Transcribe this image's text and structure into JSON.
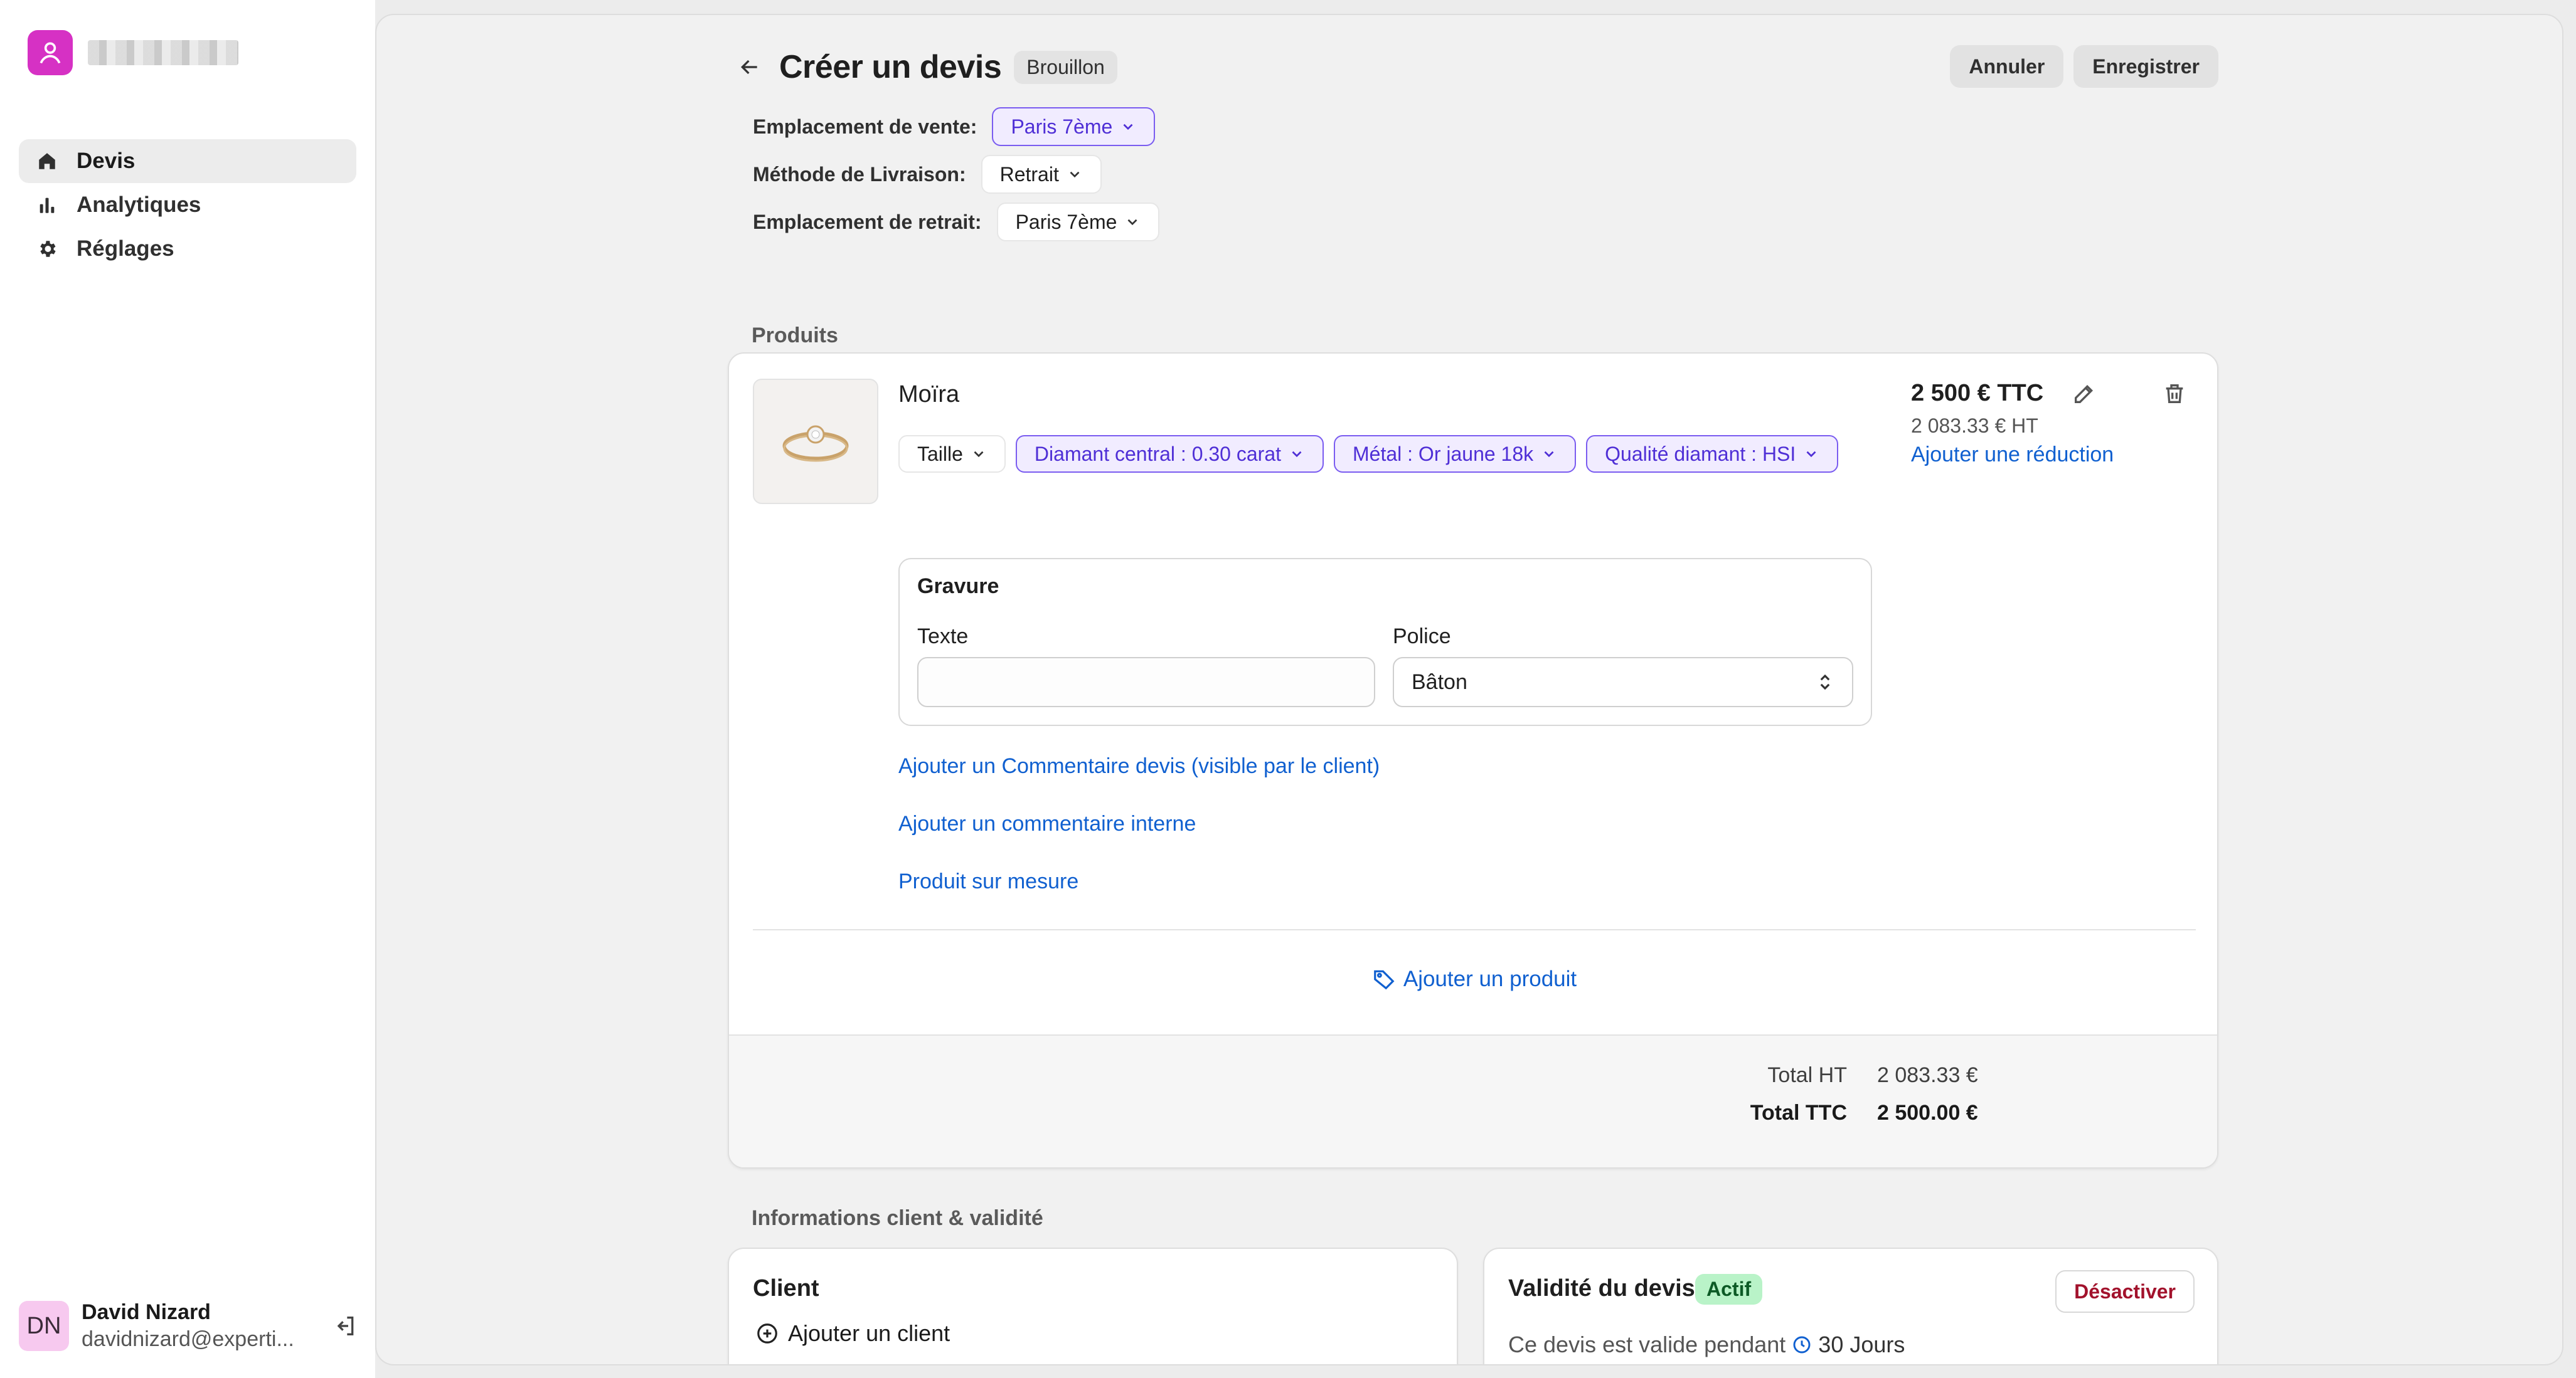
{
  "sidebar": {
    "items": [
      {
        "label": "Devis",
        "icon": "home-icon",
        "active": true
      },
      {
        "label": "Analytiques",
        "icon": "bar-chart-icon"
      },
      {
        "label": "Réglages",
        "icon": "gear-icon"
      }
    ],
    "user": {
      "initials": "DN",
      "name": "David Nizard",
      "email": "davidnizard@experti..."
    }
  },
  "header": {
    "title": "Créer un devis",
    "status": "Brouillon",
    "cancel_label": "Annuler",
    "save_label": "Enregistrer"
  },
  "meta": {
    "sale_location_label": "Emplacement de vente:",
    "sale_location_value": "Paris 7ème",
    "delivery_label": "Méthode de Livraison:",
    "delivery_value": "Retrait",
    "pickup_label": "Emplacement de retrait:",
    "pickup_value": "Paris 7ème"
  },
  "products": {
    "section_title": "Produits",
    "item": {
      "name": "Moïra",
      "options": [
        "Taille",
        "Diamant central : 0.30 carat",
        "Métal : Or jaune 18k",
        "Qualité diamant : HSI"
      ],
      "gravure_title": "Gravure",
      "text_label": "Texte",
      "text_value": "",
      "font_label": "Police",
      "font_value": "Bâton",
      "price_ttc": "2 500 € TTC",
      "price_ht": "2 083.33 € HT",
      "add_discount": "Ajouter une réduction",
      "links": [
        "Ajouter un Commentaire devis (visible par le client)",
        "Ajouter un commentaire interne",
        "Produit sur mesure"
      ]
    },
    "add_product_label": "Ajouter un produit",
    "total_ht_label": "Total HT",
    "total_ht_value": "2 083.33 €",
    "total_ttc_label": "Total TTC",
    "total_ttc_value": "2 500.00 €"
  },
  "client_section": {
    "title": "Informations client & validité",
    "client_title": "Client",
    "add_client": "Ajouter un client",
    "validity_title": "Validité du devis",
    "validity_status": "Actif",
    "deactivate_label": "Désactiver",
    "validity_text": "Ce devis est valide pendant",
    "validity_duration": "30 Jours"
  },
  "colors": {
    "brand": "#d631c4",
    "link": "#1060d0",
    "chip_purple": "#4f2fd6",
    "active_green": "#b9f3c8",
    "danger": "#a2122c"
  }
}
